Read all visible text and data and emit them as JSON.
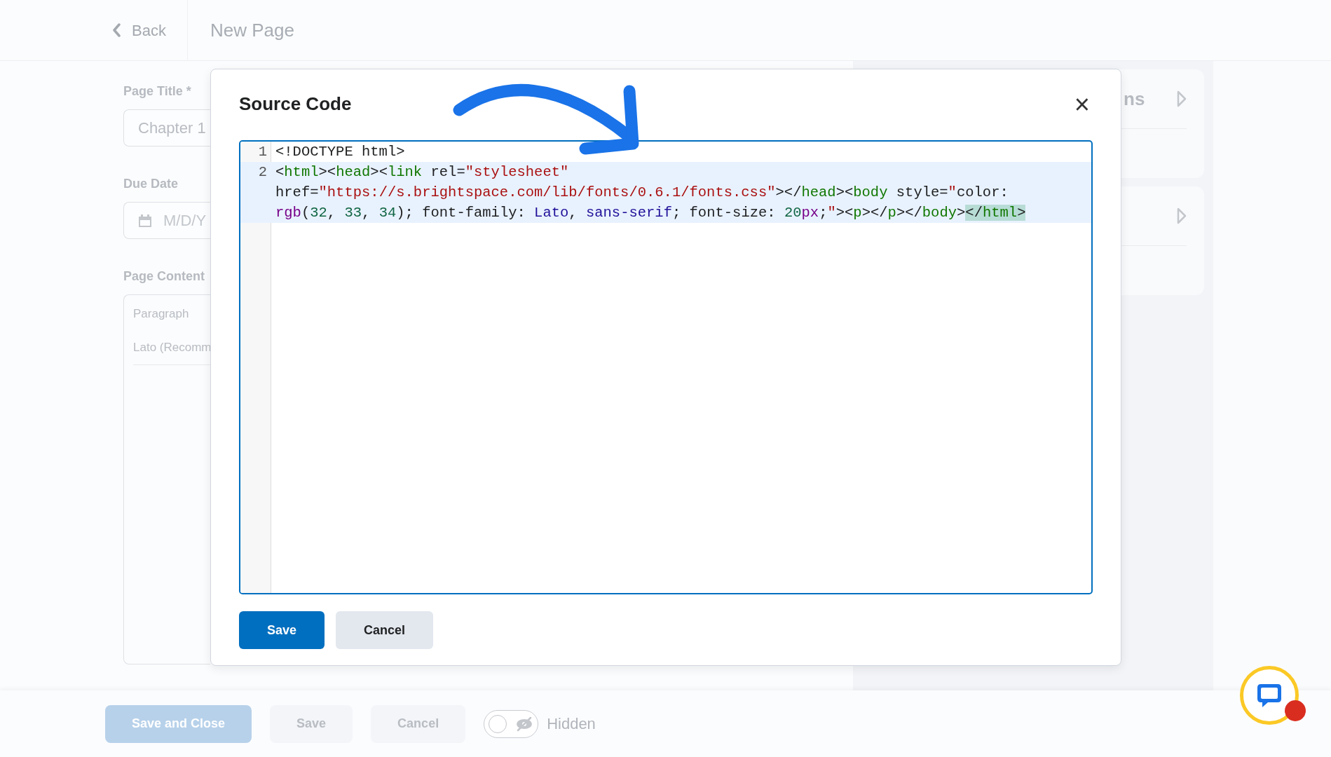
{
  "header": {
    "back": "Back",
    "title": "New Page"
  },
  "form": {
    "fields": [
      {
        "label": "Page Title *",
        "value": "Chapter 1",
        "kind": "text"
      },
      {
        "label": "Due Date",
        "placeholder": "M/D/Y",
        "kind": "date"
      },
      {
        "label": "Page Content",
        "kind": "editor",
        "toolbar": [
          "Paragraph",
          "Lato (Recomm"
        ]
      }
    ]
  },
  "side_panels": [
    {
      "title": "ns",
      "expanded": false
    },
    {
      "expanded": false
    }
  ],
  "modal": {
    "title": "Source Code",
    "close": "×",
    "code_lines": [
      {
        "number": "1",
        "active": false,
        "tokens": [
          {
            "kind": "plain",
            "text": "<!DOCTYPE html>"
          }
        ]
      },
      {
        "number": "2",
        "active": true,
        "tokens": [
          {
            "kind": "plain",
            "text": "<"
          },
          {
            "kind": "tag",
            "text": "html"
          },
          {
            "kind": "plain",
            "text": "><"
          },
          {
            "kind": "tag",
            "text": "head"
          },
          {
            "kind": "plain",
            "text": "><"
          },
          {
            "kind": "tag",
            "text": "link"
          },
          {
            "kind": "plain",
            "text": " rel="
          },
          {
            "kind": "string",
            "text": "\"stylesheet\""
          },
          {
            "kind": "plain",
            "text": " href="
          },
          {
            "kind": "string",
            "text": "\"https://s.brightspace.com/lib/fonts/0.6.1/fonts.css\""
          },
          {
            "kind": "plain",
            "text": "></"
          },
          {
            "kind": "tag",
            "text": "head"
          },
          {
            "kind": "plain",
            "text": "><"
          },
          {
            "kind": "tag",
            "text": "body"
          },
          {
            "kind": "plain",
            "text": " style="
          },
          {
            "kind": "string",
            "text": "\""
          },
          {
            "kind": "plain",
            "text": "color: "
          },
          {
            "kind": "keyword",
            "text": "rgb"
          },
          {
            "kind": "plain",
            "text": "("
          },
          {
            "kind": "number",
            "text": "32"
          },
          {
            "kind": "plain",
            "text": ", "
          },
          {
            "kind": "number",
            "text": "33"
          },
          {
            "kind": "plain",
            "text": ", "
          },
          {
            "kind": "number",
            "text": "34"
          },
          {
            "kind": "plain",
            "text": "); font-family: "
          },
          {
            "kind": "atom",
            "text": "Lato"
          },
          {
            "kind": "plain",
            "text": ", "
          },
          {
            "kind": "atom",
            "text": "sans-serif"
          },
          {
            "kind": "plain",
            "text": "; font-size: "
          },
          {
            "kind": "number",
            "text": "20"
          },
          {
            "kind": "keyword",
            "text": "px"
          },
          {
            "kind": "plain",
            "text": ";"
          },
          {
            "kind": "string",
            "text": "\""
          },
          {
            "kind": "plain",
            "text": "><"
          },
          {
            "kind": "tag",
            "text": "p"
          },
          {
            "kind": "plain",
            "text": "></"
          },
          {
            "kind": "tag",
            "text": "p"
          },
          {
            "kind": "plain",
            "text": "></"
          },
          {
            "kind": "tag",
            "text": "body"
          },
          {
            "kind": "plain",
            "text": ">"
          },
          {
            "kind": "plain",
            "text": "</",
            "highlight": true
          },
          {
            "kind": "tag",
            "text": "html",
            "highlight": true
          },
          {
            "kind": "plain",
            "text": ">",
            "highlight": true
          }
        ]
      }
    ],
    "buttons": [
      {
        "label": "Save",
        "kind": "primary"
      },
      {
        "label": "Cancel",
        "kind": "secondary"
      }
    ]
  },
  "footer": {
    "buttons": [
      {
        "label": "Save and Close",
        "kind": "primary"
      },
      {
        "label": "Save",
        "kind": "secondary"
      },
      {
        "label": "Cancel",
        "kind": "secondary"
      }
    ],
    "visibility": {
      "on": false,
      "label": "Hidden"
    }
  }
}
